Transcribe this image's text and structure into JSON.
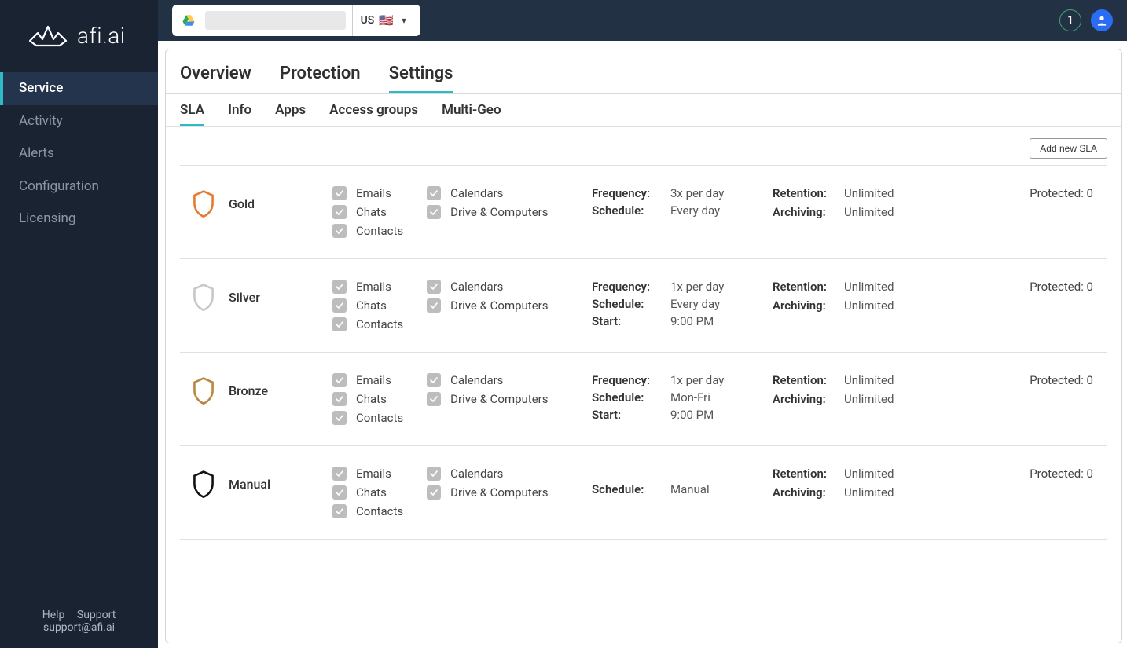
{
  "brand": "afi.ai",
  "sidebar": {
    "items": [
      {
        "label": "Service",
        "active": true
      },
      {
        "label": "Activity"
      },
      {
        "label": "Alerts"
      },
      {
        "label": "Configuration"
      },
      {
        "label": "Licensing"
      }
    ]
  },
  "footer": {
    "help": "Help",
    "support": "Support",
    "email": "support@afi.ai"
  },
  "topbar": {
    "region_code": "US",
    "region_flag": "🇺🇸",
    "notification_count": "1"
  },
  "tabs": [
    {
      "label": "Overview"
    },
    {
      "label": "Protection"
    },
    {
      "label": "Settings",
      "active": true
    }
  ],
  "subtabs": [
    {
      "label": "SLA",
      "active": true
    },
    {
      "label": "Info"
    },
    {
      "label": "Apps"
    },
    {
      "label": "Access groups"
    },
    {
      "label": "Multi-Geo"
    }
  ],
  "toolbar": {
    "add_label": "Add new SLA"
  },
  "check_labels": {
    "emails": "Emails",
    "chats": "Chats",
    "contacts": "Contacts",
    "calendars": "Calendars",
    "drive": "Drive & Computers"
  },
  "schedule_labels": {
    "frequency": "Frequency:",
    "schedule": "Schedule:",
    "start": "Start:"
  },
  "retention_labels": {
    "retention": "Retention:",
    "archiving": "Archiving:"
  },
  "protected_label": "Protected:",
  "slas": [
    {
      "name": "Gold",
      "shield_color": "#e77a2f",
      "frequency": "3x per day",
      "schedule": "Every day",
      "start": null,
      "retention": "Unlimited",
      "archiving": "Unlimited",
      "protected": "0"
    },
    {
      "name": "Silver",
      "shield_color": "#c7c7c7",
      "frequency": "1x per day",
      "schedule": "Every day",
      "start": "9:00 PM",
      "retention": "Unlimited",
      "archiving": "Unlimited",
      "protected": "0"
    },
    {
      "name": "Bronze",
      "shield_color": "#b9853f",
      "frequency": "1x per day",
      "schedule": "Mon-Fri",
      "start": "9:00 PM",
      "retention": "Unlimited",
      "archiving": "Unlimited",
      "protected": "0"
    },
    {
      "name": "Manual",
      "shield_color": "#111111",
      "frequency": null,
      "schedule": "Manual",
      "start": null,
      "retention": "Unlimited",
      "archiving": "Unlimited",
      "protected": "0"
    }
  ]
}
